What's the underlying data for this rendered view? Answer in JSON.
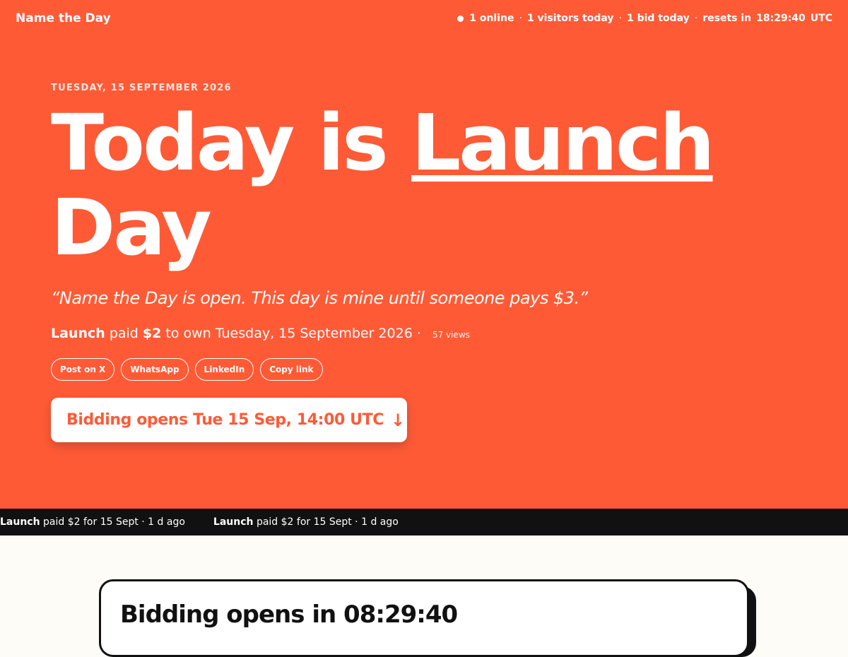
{
  "brand": "Name the Day",
  "stats": {
    "online": "1 online",
    "visitors": "1 visitors today",
    "bids": "1 bid today",
    "resets_label": "resets in",
    "resets_time": "18:29:40",
    "timezone": "UTC"
  },
  "date_label": "Tuesday, 15 September 2026",
  "headline": {
    "prefix": "Today is",
    "name": "Launch",
    "suffix": "Day"
  },
  "quote": "“Name the Day is open. This day is mine until someone pays $3.”",
  "owner": {
    "name": "Launch",
    "paid_text": "paid",
    "amount": "$2",
    "own_text": "to own Tuesday, 15 September 2026",
    "separator": "·",
    "views": "57 views"
  },
  "share_buttons": [
    "Post on X",
    "WhatsApp",
    "LinkedIn",
    "Copy link"
  ],
  "cta": {
    "label": "Bidding opens Tue 15 Sep, 14:00 UTC",
    "arrow": "↓"
  },
  "ticker": [
    {
      "name": "Launch",
      "text": "paid $2 for 15 Sept · 1 d ago"
    },
    {
      "name": "Launch",
      "text": "paid $2 for 15 Sept · 1 d ago"
    }
  ],
  "countdown": {
    "label": "Bidding opens in",
    "time": "08:29:40"
  },
  "colors": {
    "accent": "#ff5a36",
    "dark": "#111111",
    "page_bg": "#fdfcf7"
  }
}
